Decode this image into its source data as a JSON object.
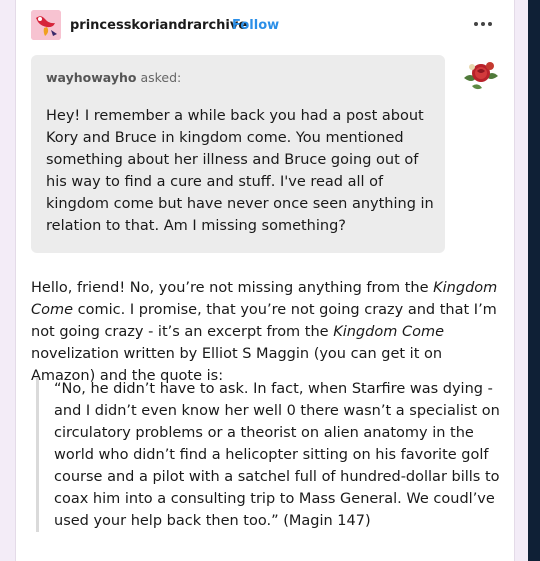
{
  "post": {
    "blog_name": "princesskoriandrarchive",
    "follow_label": "Follow",
    "more_icon": "more-dots-icon"
  },
  "ask": {
    "asker": "wayhowayho",
    "asked_label": "asked:",
    "text": "Hey! I remember a while back you had a post about Kory and Bruce in kingdom come. You mentioned something about her illness and Bruce going out of his way to find a cure and stuff. I've read all of kingdom come but have never once seen anything in relation to that. Am I missing something?"
  },
  "answer": {
    "part1": "Hello, friend! No, you’re not missing anything from the ",
    "italic1": "Kingdom Come",
    "part2": " comic. I promise, that you’re not going crazy and that I’m not going crazy - it’s an excerpt from the ",
    "italic2": "Kingdom Come",
    "part3": " novelization written by Elliot S Maggin (you can get it on Amazon) and the quote is:"
  },
  "quote": {
    "text": "“No, he didn’t have to ask. In fact, when Starfire was dying - and I didn’t even know her well 0 there wasn’t a specialist on circulatory problems or a theorist on alien anatomy in the world who didn’t find a helicopter sitting on his favorite golf course and a pilot with a satchel full of hundred-dollar bills to coax him into a consulting trip to Mass General. We coudl’ve used your help back then too.” (Magin 147)"
  },
  "colors": {
    "follow": "#2b8fe8",
    "ask_bg": "#ececec",
    "page_bg": "#f3ecf7"
  }
}
